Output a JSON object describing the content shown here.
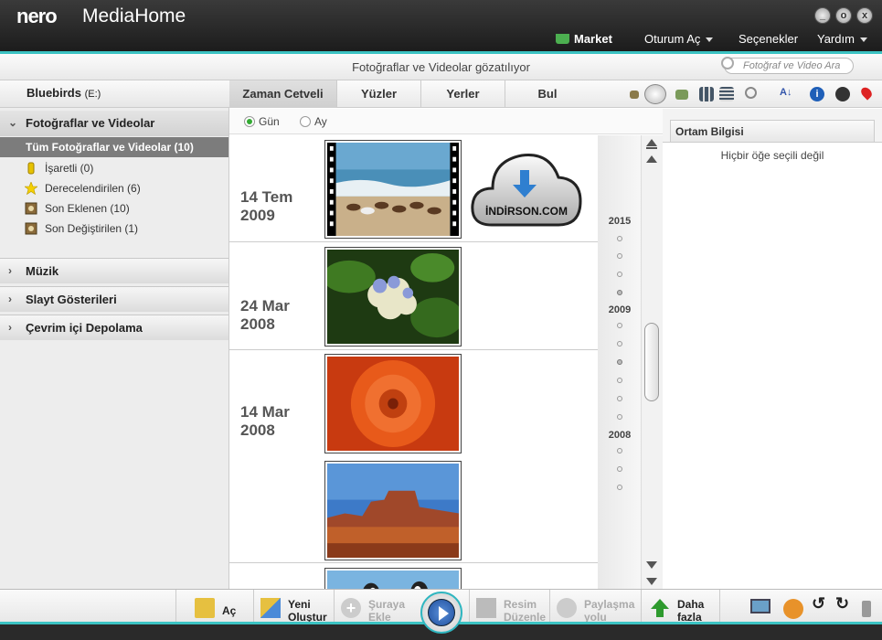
{
  "app": {
    "logo": "nero",
    "title": "MediaHome"
  },
  "window_controls": {
    "minimize": "_",
    "maximize": "o",
    "close": "x"
  },
  "menu": {
    "market": "Market",
    "login": "Oturum Aç",
    "options": "Seçenekler",
    "help": "Yardım"
  },
  "status": {
    "text": "Fotoğraflar ve Videolar gözatılıyor"
  },
  "search": {
    "placeholder": "Fotoğraf ve Video Ara"
  },
  "sidebar": {
    "device": "Bluebirds",
    "device_drive": "(E:)",
    "section_photos": "Fotoğraflar ve Videolar",
    "all_item": "Tüm Fotoğraflar ve Videolar (10)",
    "items": [
      {
        "label": "İşaretli (0)",
        "icon": "tag-icon"
      },
      {
        "label": "Derecelendirilen (6)",
        "icon": "star-icon"
      },
      {
        "label": "Son Eklenen (10)",
        "icon": "recent-added-icon"
      },
      {
        "label": "Son Değiştirilen (1)",
        "icon": "recent-modified-icon"
      }
    ],
    "section_music": "Müzik",
    "section_slides": "Slayt Gösterileri",
    "section_online": "Çevrim içi Depolama"
  },
  "tabs": [
    "Zaman Cetveli",
    "Yüzler",
    "Yerler",
    "Bul"
  ],
  "view_options": {
    "day": "Gün",
    "month": "Ay"
  },
  "groups": [
    {
      "date1": "14 Tem",
      "date2": "2009"
    },
    {
      "date1": "24 Mar",
      "date2": "2008"
    },
    {
      "date1": "14 Mar",
      "date2": "2008"
    }
  ],
  "watermark": {
    "text": "İNDİRSON.COM"
  },
  "timeline": {
    "years": [
      "2015",
      "2009",
      "2008"
    ]
  },
  "info": {
    "tab": "Ortam Bilgisi",
    "message": "Hiçbir öğe seçili değil"
  },
  "bottom": {
    "open": "Aç",
    "new_line1": "Yeni",
    "new_line2": "Oluştur",
    "add_line1": "Şuraya",
    "add_line2": "Ekle",
    "edit_line1": "Resim",
    "edit_line2": "Düzenle",
    "share_line1": "Paylaşma",
    "share_line2": "yolu",
    "more_line1": "Daha",
    "more_line2": "fazla"
  },
  "colors": {
    "accent": "#3cc3c3",
    "title_bar": "#2a2a2a",
    "selected_item": "#7c7c7c"
  }
}
